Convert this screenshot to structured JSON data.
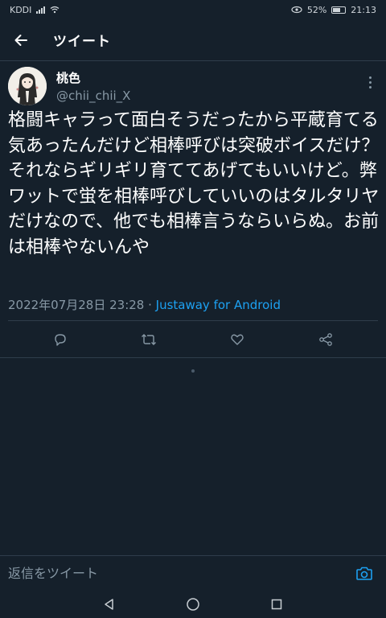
{
  "status_bar": {
    "carrier": "KDDI",
    "battery": "52%",
    "time": "21:13"
  },
  "header": {
    "title": "ツイート",
    "back_icon": "arrow-left-icon"
  },
  "tweet": {
    "author_name": "桃色",
    "author_handle": "@chii_chii_X",
    "text": "格闘キャラって面白そうだったから平蔵育てる気あったんだけど相棒呼びは突破ボイスだけ？それならギリギリ育ててあげてもいいけど。弊ワットで蛍を相棒呼びしていいのはタルタリヤだけなので、他でも相棒言うならいらぬ。お前は相棒やないんや",
    "timestamp": "2022年07月28日 23:28",
    "separator": " · ",
    "source": "Justaway for Android"
  },
  "actions": {
    "reply_icon": "reply-icon",
    "retweet_icon": "retweet-icon",
    "like_icon": "heart-icon",
    "share_icon": "share-icon"
  },
  "reply_bar": {
    "placeholder": "返信をツイート"
  },
  "colors": {
    "background": "#15202b",
    "accent": "#1da1f2",
    "muted": "#8899a6",
    "divider": "#2f3d4b"
  }
}
